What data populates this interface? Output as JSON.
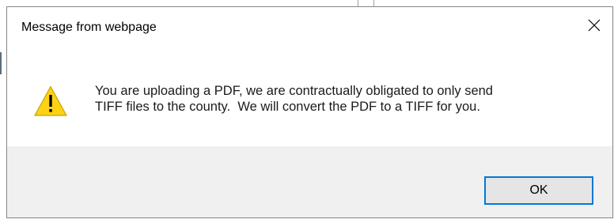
{
  "dialog": {
    "title": "Message from webpage",
    "close_icon": "close-icon",
    "warning_icon": "warning-triangle-icon",
    "message_lines": [
      "You are uploading a PDF, we are contractually obligated to only send",
      "TIFF files to the county.  We will convert the PDF to a TIFF for you."
    ],
    "ok_label": "OK"
  },
  "colors": {
    "accent": "#0078d7",
    "footer_background": "#f0f0f0",
    "warning_yellow": "#fcd116"
  }
}
